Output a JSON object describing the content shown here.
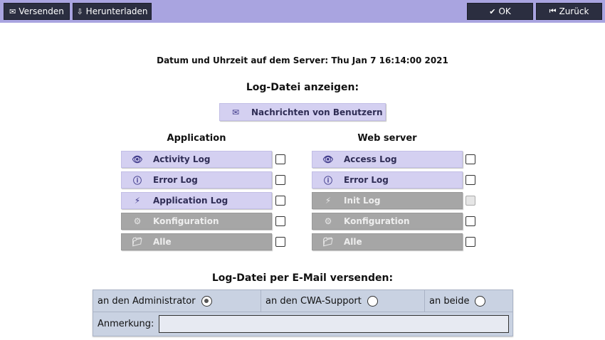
{
  "toolbar": {
    "send_label": "Versenden",
    "download_label": "Herunterladen",
    "ok_label": "OK",
    "back_label": "Zurück"
  },
  "server_time": "Datum und Uhrzeit auf dem Server: Thu Jan 7 16:14:00 2021",
  "show_log_title": "Log-Datei anzeigen:",
  "messages_button": "Nachrichten von Benutzern",
  "application": {
    "heading": "Application",
    "items": [
      {
        "label": "Activity Log",
        "icon": "eye-icon",
        "enabled": true
      },
      {
        "label": "Error Log",
        "icon": "exclamation-icon",
        "enabled": true
      },
      {
        "label": "Application Log",
        "icon": "lightning-icon",
        "enabled": true
      },
      {
        "label": "Konfiguration",
        "icon": "gear-icon",
        "enabled": false
      },
      {
        "label": "Alle",
        "icon": "folder-icon",
        "enabled": false
      }
    ]
  },
  "webserver": {
    "heading": "Web server",
    "items": [
      {
        "label": "Access Log",
        "icon": "eye-icon",
        "enabled": true
      },
      {
        "label": "Error Log",
        "icon": "exclamation-icon",
        "enabled": true
      },
      {
        "label": "Init Log",
        "icon": "lightning-icon",
        "enabled": false
      },
      {
        "label": "Konfiguration",
        "icon": "gear-icon",
        "enabled": false
      },
      {
        "label": "Alle",
        "icon": "folder-icon",
        "enabled": false
      }
    ]
  },
  "mail_title": "Log-Datei per E-Mail versenden:",
  "mail": {
    "recipients": [
      {
        "label": "an den Administrator",
        "selected": true
      },
      {
        "label": "an den CWA-Support",
        "selected": false
      },
      {
        "label": "an beide",
        "selected": false
      }
    ],
    "remark_label": "Anmerkung:",
    "remark_value": ""
  }
}
